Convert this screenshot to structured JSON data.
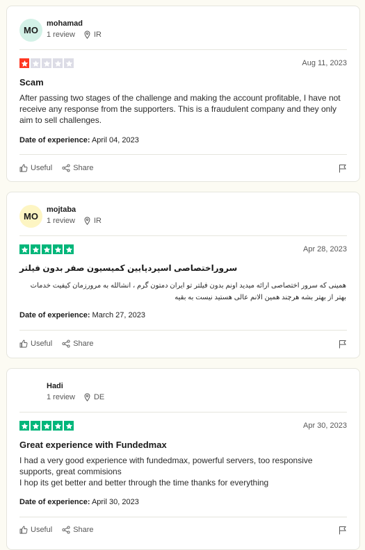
{
  "reviews": [
    {
      "initials": "MO",
      "avatar_color": "#d3f1e7",
      "name": "mohamad",
      "reviews_count": "1 review",
      "country": "IR",
      "rating": 1,
      "date": "Aug 11, 2023",
      "title": "Scam",
      "body": "After passing two stages of the challenge and making the account profitable, I have not receive any response from the supporters. This is a fraudulent company and they only aim to sell challenges.",
      "experience_label": "Date of experience:",
      "experience_date": "April 04, 2023",
      "useful_label": "Useful",
      "share_label": "Share"
    },
    {
      "initials": "MO",
      "avatar_color": "#fdf5c3",
      "name": "mojtaba",
      "reviews_count": "1 review",
      "country": "IR",
      "rating": 5,
      "date": "Apr 28, 2023",
      "title": "سروراختصاصی اسپردپایین کمیسیون صفر بدون فیلتر",
      "body": "همینی که سرور اختصاصی ارائه میدید اونم بدون فیلتر تو ایران دمتون گرم ، انشالله به مرورزمان کیفیت خدمات بهتر از بهتر بشه هرچند همین الانم عالی هستید نیست به بقیه",
      "experience_label": "Date of experience:",
      "experience_date": "March 27, 2023",
      "useful_label": "Useful",
      "share_label": "Share"
    },
    {
      "initials": "",
      "avatar_color": "#ffffff",
      "name": "Hadi",
      "reviews_count": "1 review",
      "country": "DE",
      "rating": 5,
      "date": "Apr 30, 2023",
      "title": "Great experience with Fundedmax",
      "body": "I had a very good experience with fundedmax, powerful servers, too responsive supports, great commisions\nI hop its get better and better through the time thanks for everything",
      "experience_label": "Date of experience:",
      "experience_date": "April 30, 2023",
      "useful_label": "Useful",
      "share_label": "Share"
    }
  ],
  "colors": {
    "star_one": "#ff3722",
    "star_five": "#00b67a",
    "star_empty": "#dcdce6"
  }
}
